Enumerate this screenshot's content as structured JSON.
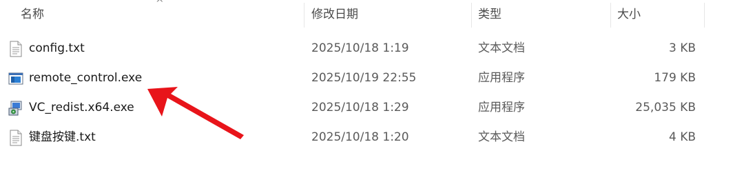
{
  "columns": {
    "name": "名称",
    "modified": "修改日期",
    "type": "类型",
    "size": "大小"
  },
  "sort_indicator": "^",
  "files": [
    {
      "name": "config.txt",
      "modified": "2025/10/18 1:19",
      "type": "文本文档",
      "size": "3 KB",
      "icon": "text-file-icon"
    },
    {
      "name": "remote_control.exe",
      "modified": "2025/10/19 22:55",
      "type": "应用程序",
      "size": "179 KB",
      "icon": "application-icon"
    },
    {
      "name": "VC_redist.x64.exe",
      "modified": "2025/10/18 1:29",
      "type": "应用程序",
      "size": "25,035 KB",
      "icon": "installer-icon"
    },
    {
      "name": "键盘按键.txt",
      "modified": "2025/10/18 1:20",
      "type": "文本文档",
      "size": "4 KB",
      "icon": "text-file-icon"
    }
  ],
  "annotation": {
    "arrow_color": "#e8141a",
    "points_to": "remote_control.exe"
  }
}
